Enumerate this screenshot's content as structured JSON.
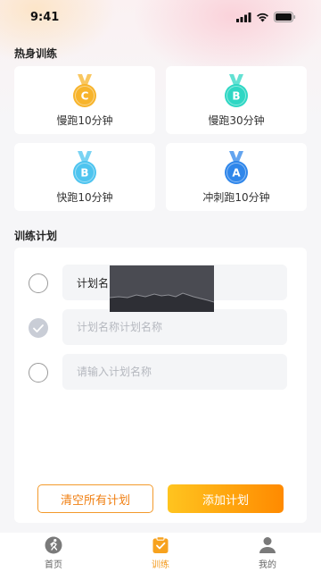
{
  "status": {
    "time": "9:41"
  },
  "sections": {
    "hot_title": "热身训练",
    "plan_title": "训练计划"
  },
  "cards": [
    {
      "label": "慢跑10分钟",
      "grade": "C",
      "color": "#f7b42c"
    },
    {
      "label": "慢跑30分钟",
      "grade": "B",
      "color": "#2fd7c4"
    },
    {
      "label": "快跑10分钟",
      "grade": "B",
      "color": "#4ec4ef"
    },
    {
      "label": "冲刺跑10分钟",
      "grade": "A",
      "color": "#2f86ea"
    }
  ],
  "plans": [
    {
      "value": "计划名",
      "placeholder": ""
    },
    {
      "value": "",
      "placeholder": "计划名称计划名称"
    },
    {
      "value": "",
      "placeholder": "请输入计划名称"
    }
  ],
  "buttons": {
    "clear": "清空所有计划",
    "add": "添加计划"
  },
  "tabs": [
    {
      "label": "首页"
    },
    {
      "label": "训练"
    },
    {
      "label": "我的"
    }
  ],
  "colors": {
    "accent": "#f39a1d",
    "checked_radio": "#c9cdd6"
  }
}
